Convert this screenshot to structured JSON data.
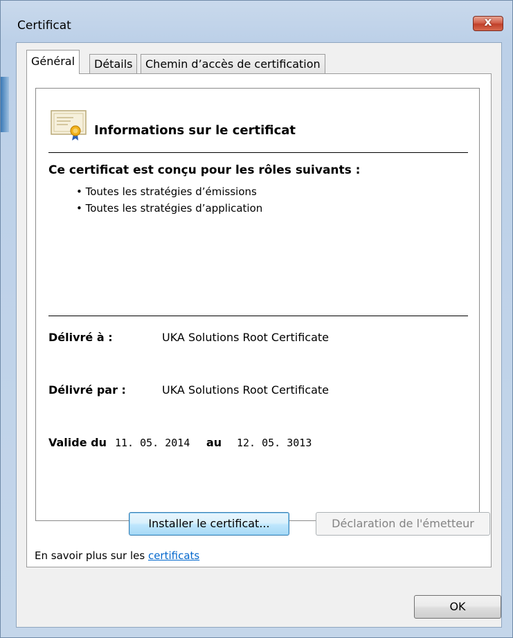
{
  "window": {
    "title": "Certificat",
    "close_symbol": "x"
  },
  "tabs": [
    {
      "label": "Général",
      "active": true
    },
    {
      "label": "Détails",
      "active": false
    },
    {
      "label": "Chemin d’accès de certification",
      "active": false
    }
  ],
  "info": {
    "title": "Informations sur le certificat",
    "roles_heading": "Ce certificat est conçu pour les rôles suivants :",
    "roles": [
      "• Toutes les stratégies d’émissions",
      "• Toutes les stratégies d’application"
    ]
  },
  "fields": {
    "issued_to_label": "Délivré à :",
    "issued_to_value": "UKA Solutions Root Certificate",
    "issued_by_label": "Délivré par :",
    "issued_by_value": "UKA Solutions Root Certificate",
    "valid_from_label": "Valide du",
    "valid_from_value": "11. 05. 2014",
    "valid_to_label": "au",
    "valid_to_value": "12. 05. 3013"
  },
  "buttons": {
    "install": "Installer le certificat...",
    "declaration": "Déclaration de l'émetteur",
    "ok": "OK"
  },
  "learn_more": {
    "prefix": "En savoir plus sur les",
    "link": "certificats"
  },
  "icons": {
    "certificate": "certificate-icon",
    "close": "close-icon"
  },
  "colors": {
    "link": "#0066cc",
    "close_button": "#c0402a",
    "install_button_border": "#3c7fb1"
  }
}
